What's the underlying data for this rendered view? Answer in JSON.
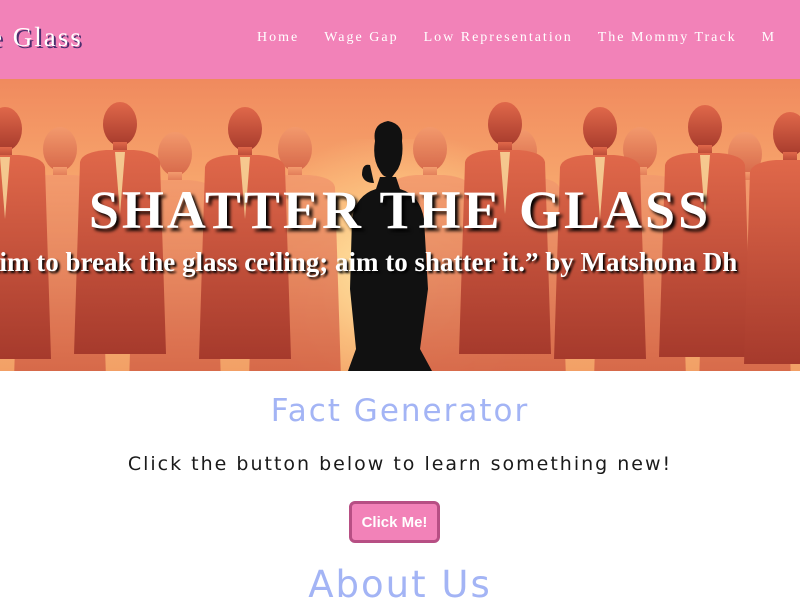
{
  "navbar": {
    "brand": "e Glass",
    "links": [
      {
        "label": "Home"
      },
      {
        "label": "Wage Gap"
      },
      {
        "label": "Low Representation"
      },
      {
        "label": "The Mommy Track"
      },
      {
        "label": "M"
      }
    ],
    "background_color": "#f282b8"
  },
  "hero": {
    "title": "SHATTER THE GLASS",
    "quote": "aim to break the glass ceiling; aim to shatter it.” by Matshona Dh"
  },
  "fact_section": {
    "heading": "Fact Generator",
    "text": "Click the button below to learn something new!",
    "button_label": "Click Me!",
    "heading_color": "#a3b4f5",
    "button_color": "#f282b8"
  },
  "about_section": {
    "heading": "About Us"
  }
}
